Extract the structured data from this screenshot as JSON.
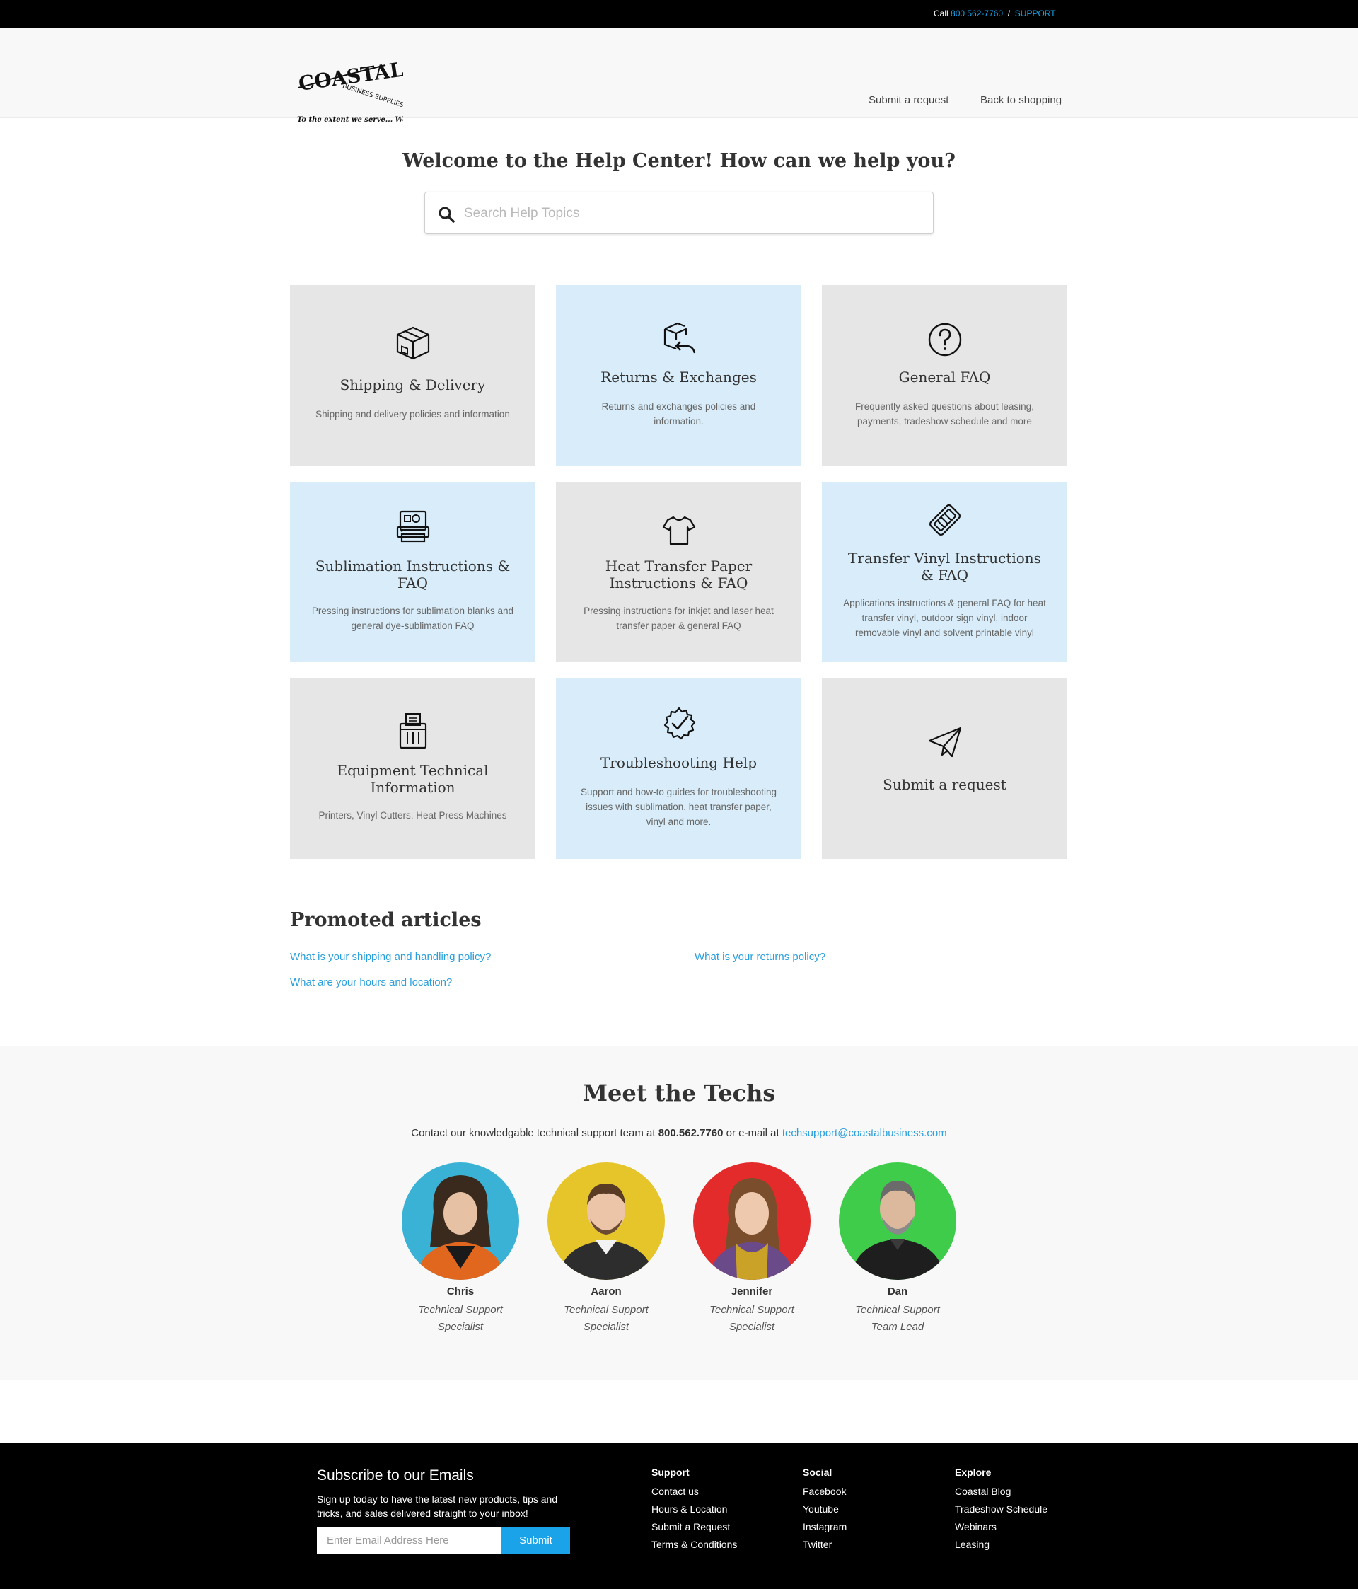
{
  "topbar": {
    "call_prefix": "Call",
    "phone": "800 562-7760",
    "separator": "/",
    "support_label": "SUPPORT"
  },
  "header": {
    "logo_text": "COASTAL",
    "logo_subtext": "BUSINESS SUPPLIES",
    "logo_tagline": "To the extent we serve... We Succeed!",
    "nav": {
      "submit_request": "Submit a request",
      "back_to_shopping": "Back to shopping"
    }
  },
  "hero": {
    "title": "Welcome to the Help Center! How can we help you?",
    "search_placeholder": "Search Help Topics"
  },
  "categories": [
    {
      "icon": "box-icon",
      "title": "Shipping & Delivery",
      "desc": "Shipping and delivery policies and information"
    },
    {
      "icon": "return-box-icon",
      "title": "Returns & Exchanges",
      "desc": "Returns and exchanges policies and information."
    },
    {
      "icon": "question-circle-icon",
      "title": "General FAQ",
      "desc": "Frequently asked questions about leasing, payments, tradeshow schedule and more"
    },
    {
      "icon": "printer-icon",
      "title": "Sublimation Instructions & FAQ",
      "desc": "Pressing instructions for sublimation blanks and general dye-sublimation FAQ"
    },
    {
      "icon": "tshirt-icon",
      "title": "Heat Transfer Paper Instructions & FAQ",
      "desc": "Pressing instructions for inkjet and laser heat transfer paper & general FAQ"
    },
    {
      "icon": "vinyl-tag-icon",
      "title": "Transfer Vinyl Instructions & FAQ",
      "desc": "Applications instructions & general FAQ for heat transfer vinyl, outdoor sign vinyl, indoor removable vinyl and solvent printable vinyl"
    },
    {
      "icon": "shredder-icon",
      "title": "Equipment Technical Information",
      "desc": "Printers, Vinyl Cutters, Heat Press Machines"
    },
    {
      "icon": "gear-check-icon",
      "title": "Troubleshooting Help",
      "desc": "Support and how-to guides for troubleshooting issues with sublimation, heat transfer paper, vinyl and more."
    },
    {
      "icon": "paper-plane-icon",
      "title": "Submit a request",
      "desc": ""
    }
  ],
  "promoted": {
    "heading": "Promoted articles",
    "links": [
      "What is your shipping and handling policy?",
      "What is your returns policy?",
      "What are your hours and location?"
    ]
  },
  "techs": {
    "title": "Meet the Techs",
    "contact_prefix": "Contact our knowledgable technical support team at",
    "phone": "800.562.7760",
    "contact_mid": "or e-mail at",
    "email": "techsupport@coastalbusiness.com",
    "people": [
      {
        "name": "Chris",
        "role": "Technical Support Specialist",
        "bg": "#3ab2d6"
      },
      {
        "name": "Aaron",
        "role": "Technical Support Specialist",
        "bg": "#e6c52a"
      },
      {
        "name": "Jennifer",
        "role": "Technical Support Specialist",
        "bg": "#e32b2b"
      },
      {
        "name": "Dan",
        "role": "Technical Support Team Lead",
        "bg": "#3fcc4a"
      }
    ]
  },
  "footer": {
    "subscribe_title": "Subscribe to our Emails",
    "subscribe_text": "Sign up today to have the latest new products, tips and tricks, and sales delivered straight to your inbox!",
    "email_placeholder": "Enter Email Address Here",
    "submit_label": "Submit",
    "columns": [
      {
        "heading": "Support",
        "items": [
          "Contact us",
          "Hours & Location",
          "Submit a Request",
          "Terms & Conditions"
        ]
      },
      {
        "heading": "Social",
        "items": [
          "Facebook",
          "Youtube",
          "Instagram",
          "Twitter"
        ]
      },
      {
        "heading": "Explore",
        "items": [
          "Coastal Blog",
          "Tradeshow Schedule",
          "Webinars",
          "Leasing"
        ]
      }
    ]
  },
  "colors": {
    "accent": "#1aa3e8",
    "link": "#2a9fdb",
    "card_gray": "#e6e6e6",
    "card_blue": "#d8edf9"
  }
}
